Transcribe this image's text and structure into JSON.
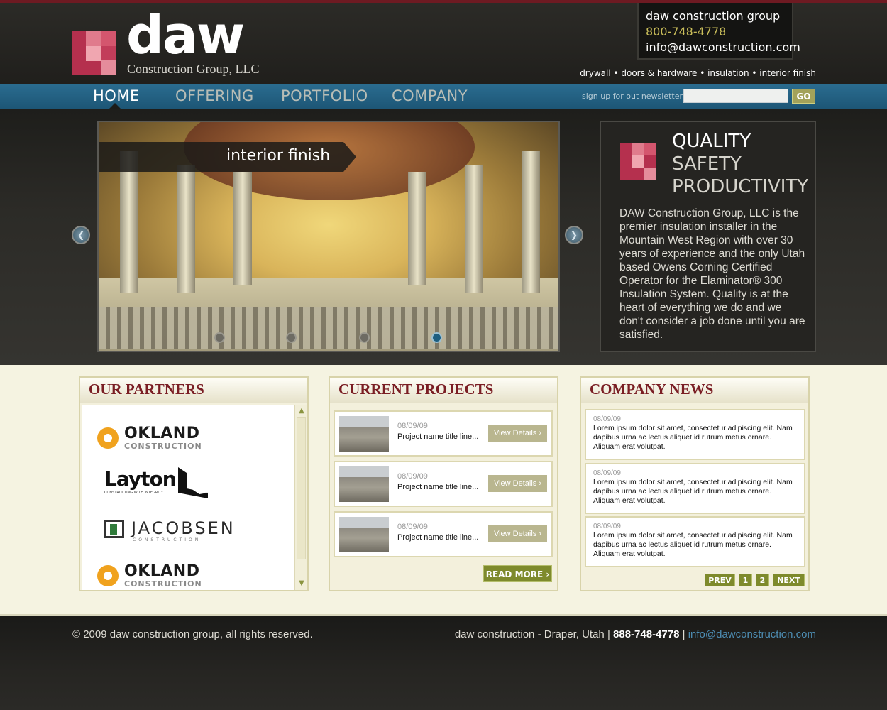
{
  "brand": {
    "name": "daw",
    "subtitle": "Construction Group, LLC"
  },
  "contact": {
    "company": "daw construction group",
    "phone": "800-748-4778",
    "email": "info@dawconstruction.com"
  },
  "services": "drywall • doors & hardware • insulation • interior finish",
  "nav": {
    "items": [
      "HOME",
      "OFFERING",
      "PORTFOLIO",
      "COMPANY"
    ],
    "active": "HOME"
  },
  "newsletter": {
    "label": "sign up for out newsletter",
    "placeholder": "",
    "button": "GO"
  },
  "slider": {
    "caption": "interior finish",
    "prev": "❮",
    "next": "❯",
    "slides": 4,
    "active_slide": 4
  },
  "quality": {
    "line1": "QUALITY",
    "line2": "SAFETY",
    "line3": "PRODUCTIVITY",
    "body": "DAW Construction Group, LLC is the premier insulation installer in the Mountain West Region with over 30 years of experience and the only Utah based Owens Corning Certified Operator for the Elaminator® 300 Insulation System. Quality is at the heart of everything we do and we don't consider a job done until you are satisfied."
  },
  "partners": {
    "title": "OUR PARTNERS",
    "logos": [
      {
        "name": "OKLAND",
        "sub": "CONSTRUCTION"
      },
      {
        "name": "Layton",
        "sub": "CONSTRUCTING WITH INTEGRITY"
      },
      {
        "name": "JACOBSEN",
        "sub": "CONSTRUCTION"
      },
      {
        "name": "OKLAND",
        "sub": "CONSTRUCTION"
      }
    ]
  },
  "projects": {
    "title": "CURRENT PROJECTS",
    "items": [
      {
        "date": "08/09/09",
        "name": "Project name title line...",
        "button": "View Details ›"
      },
      {
        "date": "08/09/09",
        "name": "Project name title line...",
        "button": "View Details ›"
      },
      {
        "date": "08/09/09",
        "name": "Project name title line...",
        "button": "View Details ›"
      }
    ],
    "read_more": "READ MORE ›"
  },
  "news": {
    "title": "COMPANY NEWS",
    "items": [
      {
        "date": "08/09/09",
        "text": "Lorem ipsum dolor sit amet, consectetur adipiscing elit. Nam dapibus urna ac lectus aliquet id rutrum metus ornare. Aliquam erat volutpat."
      },
      {
        "date": "08/09/09",
        "text": "Lorem ipsum dolor sit amet, consectetur adipiscing elit. Nam dapibus urna ac lectus aliquet id rutrum metus ornare. Aliquam erat volutpat."
      },
      {
        "date": "08/09/09",
        "text": "Lorem ipsum dolor sit amet, consectetur adipiscing elit. Nam dapibus urna ac lectus aliquet id rutrum metus ornare. Aliquam erat volutpat."
      }
    ],
    "pager": {
      "prev": "PREV",
      "pages": [
        "1",
        "2"
      ],
      "next": "NEXT"
    }
  },
  "footer": {
    "copyright": "© 2009 daw construction group, all rights reserved.",
    "location": "daw construction - Draper, Utah |",
    "phone": "888-748-4778",
    "sep": "|",
    "email": "info@dawconstruction.com"
  },
  "colors": {
    "accent_red": "#7a1e24",
    "nav_blue": "#2a6c8f",
    "olive": "#7e8a2c",
    "logo_pink": "#c23d5a"
  }
}
